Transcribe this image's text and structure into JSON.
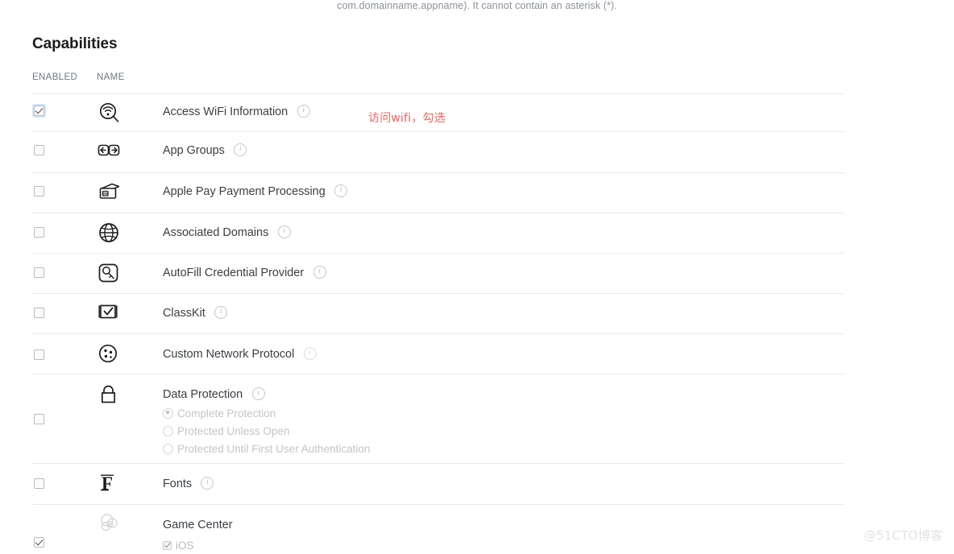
{
  "top_hint": "com.domainname.appname). It cannot contain an asterisk (*).",
  "section": {
    "title": "Capabilities"
  },
  "table": {
    "headers": {
      "enabled": "ENABLED",
      "name": "NAME"
    },
    "rows": [
      {
        "name": "Access WiFi Information",
        "icon": "wifi-magnifier-icon",
        "enabled": true,
        "focused": true,
        "has_info": true
      },
      {
        "name": "App Groups",
        "icon": "app-groups-arrows-icon",
        "enabled": false,
        "focused": false,
        "has_info": true
      },
      {
        "name": "Apple Pay Payment Processing",
        "icon": "apple-pay-wallet-icon",
        "enabled": false,
        "focused": false,
        "has_info": true
      },
      {
        "name": "Associated Domains",
        "icon": "globe-icon",
        "enabled": false,
        "focused": false,
        "has_info": true
      },
      {
        "name": "AutoFill Credential Provider",
        "icon": "key-square-icon",
        "enabled": false,
        "focused": false,
        "has_info": true
      },
      {
        "name": "ClassKit",
        "icon": "classkit-checkmark-icon",
        "enabled": false,
        "focused": false,
        "has_info": true
      },
      {
        "name": "Custom Network Protocol",
        "icon": "network-dots-icon",
        "enabled": false,
        "focused": false,
        "has_info": true
      },
      {
        "name": "Data Protection",
        "icon": "lock-icon",
        "enabled": false,
        "focused": false,
        "has_info": true,
        "radio_options": [
          {
            "label": "Complete Protection",
            "selected": true
          },
          {
            "label": "Protected Unless Open",
            "selected": false
          },
          {
            "label": "Protected Until First User Authentication",
            "selected": false
          }
        ]
      },
      {
        "name": "Fonts",
        "icon": "fonts-f-icon",
        "enabled": false,
        "focused": false,
        "has_info": true
      },
      {
        "name": "Game Center",
        "icon": "game-center-bubbles-icon",
        "enabled": true,
        "focused": false,
        "has_info": false,
        "sub_checkboxes": [
          {
            "label": "iOS",
            "checked": true
          }
        ]
      }
    ]
  },
  "annotation": {
    "text": "访问wifi，勾选",
    "color": "#f4645f"
  },
  "watermark": "@51CTO博客"
}
